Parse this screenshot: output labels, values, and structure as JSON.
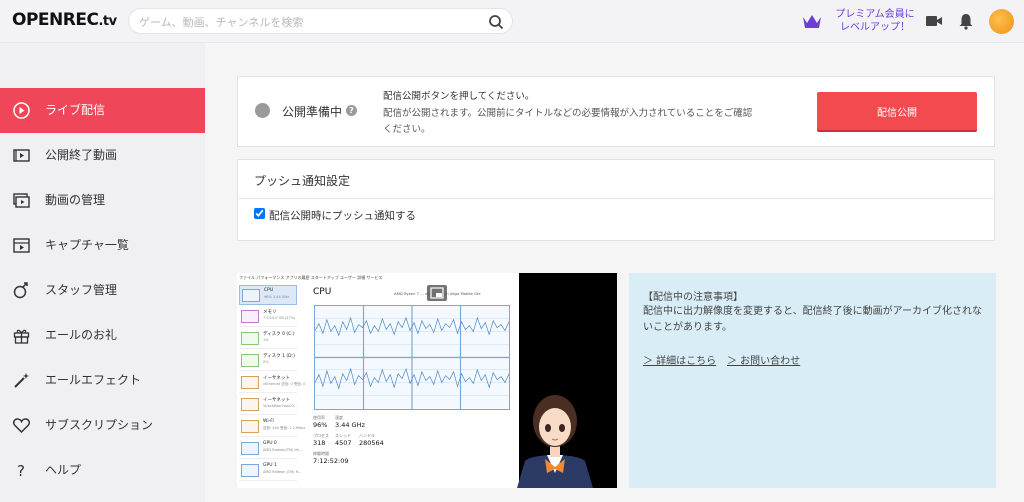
{
  "header": {
    "logo_main": "OPENREC",
    "logo_tv": ".tv",
    "search_placeholder": "ゲーム、動画、チャンネルを検索",
    "search_value": "",
    "premium_line1": "プレミアム会員に",
    "premium_line2": "レベルアップ！",
    "accent_color": "#6b3fd6"
  },
  "sidebar": {
    "items": [
      {
        "label": "ライブ配信",
        "icon": "live-icon",
        "active": true
      },
      {
        "label": "公開終了動画",
        "icon": "ended-video-icon",
        "active": false
      },
      {
        "label": "動画の管理",
        "icon": "video-manage-icon",
        "active": false
      },
      {
        "label": "キャプチャ一覧",
        "icon": "capture-icon",
        "active": false
      },
      {
        "label": "スタッフ管理",
        "icon": "staff-icon",
        "active": false
      },
      {
        "label": "エールのお礼",
        "icon": "gift-icon",
        "active": false
      },
      {
        "label": "エールエフェクト",
        "icon": "magic-wand-icon",
        "active": false
      },
      {
        "label": "サブスクリプション",
        "icon": "heart-icon",
        "active": false
      },
      {
        "label": "ヘルプ",
        "icon": "question-icon",
        "active": false
      }
    ],
    "active_color": "#f0465a"
  },
  "status": {
    "label": "公開準備中",
    "help": "?",
    "info_line1": "配信公開ボタンを押してください。",
    "info_line2": "配信が公開されます。公開前にタイトルなどの必要情報が入力されていることをご確認ください。",
    "publish_button": "配信公開",
    "publish_color": "#f34a4f"
  },
  "push": {
    "title": "プッシュ通知設定",
    "checkbox_label": "配信公開時にプッシュ通知する",
    "checked": true
  },
  "preview": {
    "menu": "ファイル  パフォーマンス  アプリの履歴  スタートアップ  ユーザー  詳細  サービス",
    "side_items": [
      {
        "t1": "CPU",
        "t2": "96%  3.44 GHz"
      },
      {
        "t1": "メモリ",
        "t2": "7.5/15.9 GB (47%)"
      },
      {
        "t1": "ディスク 0 (C:)",
        "t2": "1%"
      },
      {
        "t1": "ディスク 1 (D:)",
        "t2": "0%"
      },
      {
        "t1": "イーサネット",
        "t2": "vEthernet  送信: 0  受信: 0"
      },
      {
        "t1": "イーサネット",
        "t2": "VirtualBox Host-O..."
      },
      {
        "t1": "Wi-Fi",
        "t2": "送信: 440  受信: 1.2 Mbps"
      },
      {
        "t1": "GPU 0",
        "t2": "AMD Radeon(TM) Ve..."
      },
      {
        "t1": "GPU 1",
        "t2": "AMD Radeon (TM) R..."
      }
    ],
    "cpu_title": "CPU",
    "cpu_model": "AMD Ryzen 7 ... with Radeon Vega Mobile Gfx",
    "stats": {
      "util_label": "使用率",
      "util": "96%",
      "speed_label": "速度",
      "speed": "3.44 GHz",
      "proc_label": "プロセス",
      "proc": "318",
      "threads_label": "スレッド",
      "threads": "4507",
      "handles_label": "ハンドル",
      "handles": "280564",
      "uptime_label": "稼働時間",
      "uptime": "7:12:52:09"
    }
  },
  "notes": {
    "heading": "【配信中の注意事項】",
    "body": "配信中に出力解像度を変更すると、配信終了後に動画がアーカイブ化されないことがあります。",
    "link_details": "＞ 詳細はこちら",
    "link_contact": "＞ お問い合わせ"
  }
}
